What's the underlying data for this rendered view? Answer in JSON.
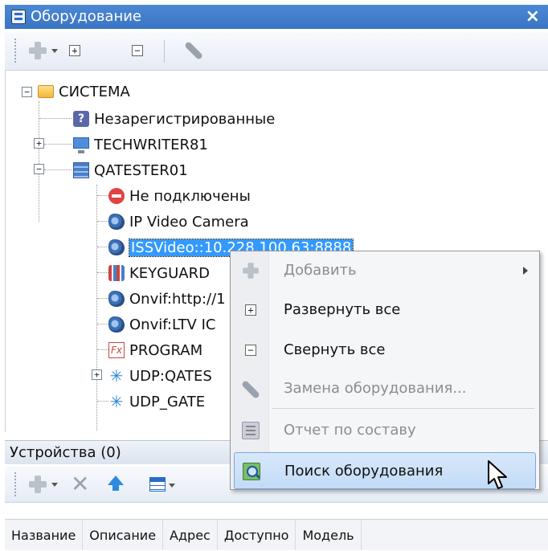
{
  "window": {
    "title": "Оборудование",
    "close_glyph": "×"
  },
  "toolbar": {
    "expand_glyph": "+",
    "collapse_glyph": "−"
  },
  "tree": {
    "root": "СИСТЕМА",
    "unregistered": "Незарегистрированные",
    "host1": "TECHWRITER81",
    "host2": "QATESTER01",
    "children": [
      {
        "label": "Не подключены",
        "icon": "no-entry-icon"
      },
      {
        "label": "IP Video Camera",
        "icon": "camera-icon"
      },
      {
        "label": "ISSVideo::10.228.100.63:8888",
        "icon": "camera-icon",
        "selected": true
      },
      {
        "label": "KEYGUARD",
        "icon": "keyguard-icon"
      },
      {
        "label": "Onvif:http://1",
        "icon": "camera-icon"
      },
      {
        "label": "Onvif:LTV IC",
        "icon": "camera-icon"
      },
      {
        "label": "PROGRAM",
        "icon": "program-icon"
      },
      {
        "label": "UDP:QATES",
        "icon": "network-icon"
      },
      {
        "label": "UDP_GATE",
        "icon": "network-icon"
      }
    ]
  },
  "devices_panel": {
    "header": "Устройства (0)",
    "columns": [
      "Название",
      "Описание",
      "Адрес",
      "Доступно",
      "Модель"
    ]
  },
  "context_menu": {
    "items": [
      {
        "label": "Добавить",
        "disabled": true,
        "submenu": true,
        "icon": "plus-icon"
      },
      {
        "label": "Развернуть все",
        "disabled": false,
        "icon": "expand-all-icon",
        "glyph": "+"
      },
      {
        "label": "Свернуть все",
        "disabled": false,
        "icon": "collapse-all-icon",
        "glyph": "−"
      },
      {
        "label": "Замена оборудования...",
        "disabled": true,
        "icon": "wrench-icon"
      },
      {
        "label": "Отчет по составу",
        "disabled": true,
        "icon": "report-icon"
      },
      {
        "label": "Поиск оборудования",
        "disabled": false,
        "highlighted": true,
        "icon": "search-hardware-icon"
      }
    ]
  },
  "colors": {
    "titlebar": "#3a74c4",
    "selection": "#3399ff",
    "menu_highlight": "#c3dbf6"
  }
}
